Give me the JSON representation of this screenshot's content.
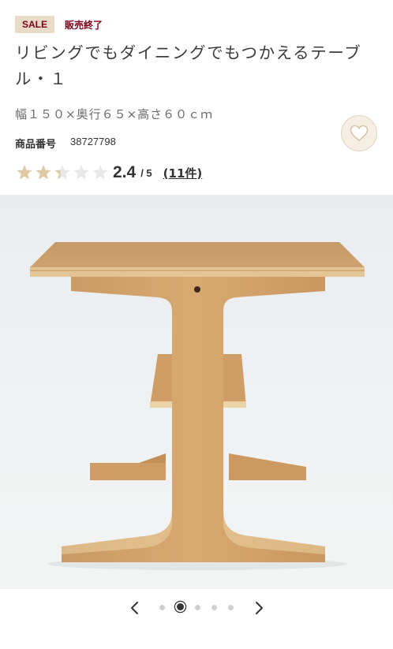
{
  "badges": {
    "sale": "SALE",
    "status": "販売終了"
  },
  "product": {
    "title": "リビングでもダイニングでもつかえるテーブル・１",
    "size": "幅１５０×奥行６５×高さ６０ｃｍ",
    "number_label": "商品番号",
    "number": "38727798"
  },
  "rating": {
    "value": 2.4,
    "score": "2.4",
    "max": "/ 5",
    "count": "(11件)"
  },
  "favorite": {
    "icon": "heart-icon"
  },
  "gallery": {
    "image": "wooden-table-side-view",
    "current_index": 2,
    "total": 5
  },
  "colors": {
    "sale_bg": "#e9dcc7",
    "sale_text": "#7f0019",
    "star_filled": "#e0caa5",
    "star_empty": "#e8e8e8"
  }
}
